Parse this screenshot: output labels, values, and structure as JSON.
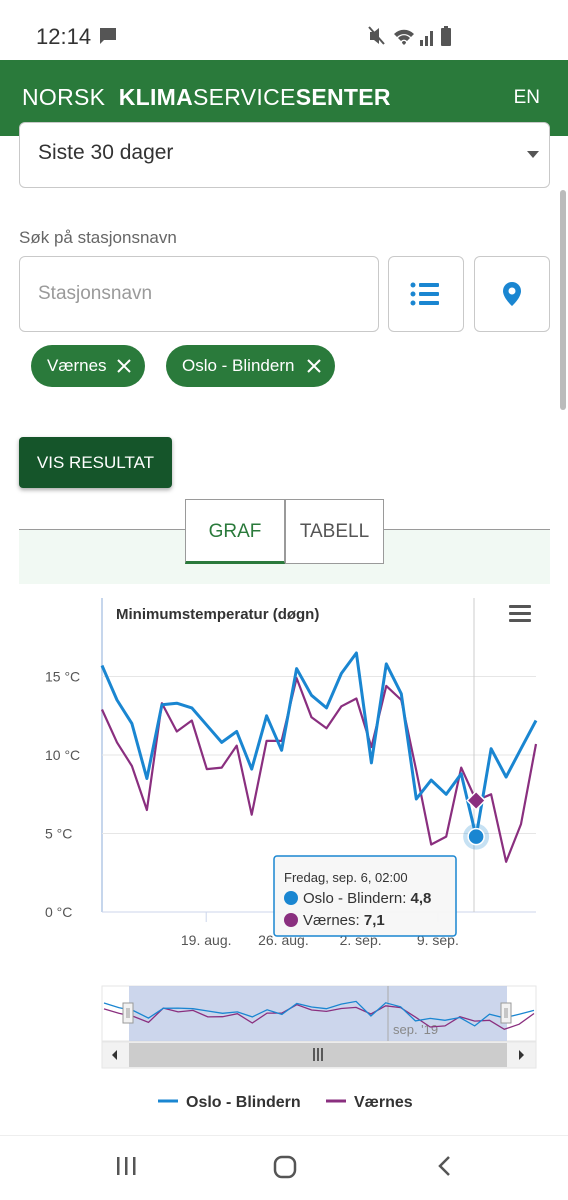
{
  "status": {
    "time": "12:14"
  },
  "header": {
    "logo_norsk": "NORSK",
    "logo_klima": "KLIMA",
    "logo_service": "SERVICE",
    "logo_senter": "SENTER",
    "lang": "EN"
  },
  "period": {
    "value": "Siste 30 dager"
  },
  "search": {
    "label": "Søk på stasjonsnavn",
    "placeholder": "Stasjonsnavn"
  },
  "chips": [
    {
      "label": "Værnes"
    },
    {
      "label": "Oslo - Blindern"
    }
  ],
  "actions": {
    "vis_resultat": "VIS RESULTAT"
  },
  "tabs": [
    {
      "label": "GRAF",
      "active": true
    },
    {
      "label": "TABELL",
      "active": false
    }
  ],
  "colors": {
    "brand": "#2a7a3b",
    "brand_dark": "#15552a",
    "oslo": "#1a86d1",
    "vaernes": "#8a2f7f"
  },
  "chart_data": {
    "type": "line",
    "title": "Minimumstemperatur (døgn)",
    "y_ticks": [
      "15 °C",
      "10 °C",
      "5 °C",
      "0 °C"
    ],
    "x_ticks": [
      "19. aug.",
      "26. aug.",
      "2. sep.",
      "9. sep."
    ],
    "ylim": [
      0,
      17
    ],
    "x": [
      "2019-08-12",
      "2019-08-13",
      "2019-08-14",
      "2019-08-15",
      "2019-08-16",
      "2019-08-17",
      "2019-08-18",
      "2019-08-19",
      "2019-08-20",
      "2019-08-21",
      "2019-08-22",
      "2019-08-23",
      "2019-08-24",
      "2019-08-25",
      "2019-08-26",
      "2019-08-27",
      "2019-08-28",
      "2019-08-29",
      "2019-08-30",
      "2019-08-31",
      "2019-09-01",
      "2019-09-02",
      "2019-09-03",
      "2019-09-04",
      "2019-09-05",
      "2019-09-06",
      "2019-09-07",
      "2019-09-08",
      "2019-09-09",
      "2019-09-10"
    ],
    "series": [
      {
        "name": "Oslo - Blindern",
        "values": [
          15.7,
          13.5,
          12.0,
          8.5,
          13.2,
          13.3,
          13.0,
          11.9,
          10.8,
          11.5,
          9.1,
          12.5,
          10.3,
          15.5,
          13.8,
          13.0,
          15.2,
          16.5,
          9.5,
          15.8,
          13.9,
          7.2,
          8.4,
          7.5,
          8.8,
          4.8,
          10.4,
          8.6,
          10.4,
          12.2
        ]
      },
      {
        "name": "Værnes",
        "values": [
          12.9,
          10.8,
          9.3,
          6.5,
          13.3,
          11.5,
          12.2,
          9.1,
          9.2,
          10.6,
          6.2,
          10.9,
          10.9,
          14.9,
          12.4,
          11.7,
          13.1,
          13.6,
          10.5,
          14.4,
          13.5,
          9.0,
          4.3,
          4.8,
          9.2,
          7.1,
          7.5,
          3.2,
          5.6,
          10.7
        ]
      }
    ],
    "tooltip": {
      "title": "Fredag, sep. 6, 02:00",
      "rows": [
        {
          "label": "Oslo - Blindern:",
          "value": "4,8"
        },
        {
          "label": "Værnes:",
          "value": "7,1"
        }
      ]
    },
    "navigator_label": "sep. '19",
    "legend": [
      "Oslo - Blindern",
      "Værnes"
    ]
  }
}
